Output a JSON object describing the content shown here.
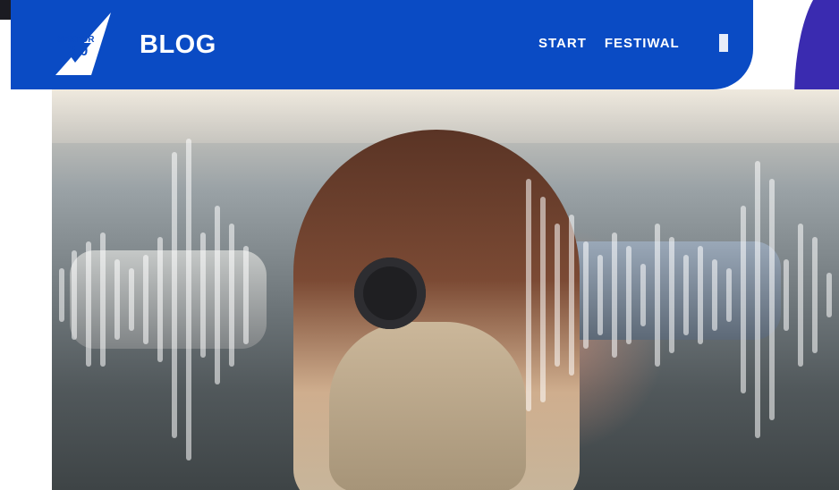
{
  "header": {
    "logo_text_top": "SEKTOR",
    "logo_text_bottom": "3.0",
    "title": "BLOG",
    "nav": [
      {
        "label": "START"
      },
      {
        "label": "FESTIWAL"
      }
    ]
  },
  "colors": {
    "header_bg": "#0a4bc4",
    "accent_purple": "#3a2bb0",
    "text_light": "#ffffff"
  },
  "hero": {
    "image_alt": "Woman with headphones looking up",
    "icon": "waveform-overlay"
  }
}
